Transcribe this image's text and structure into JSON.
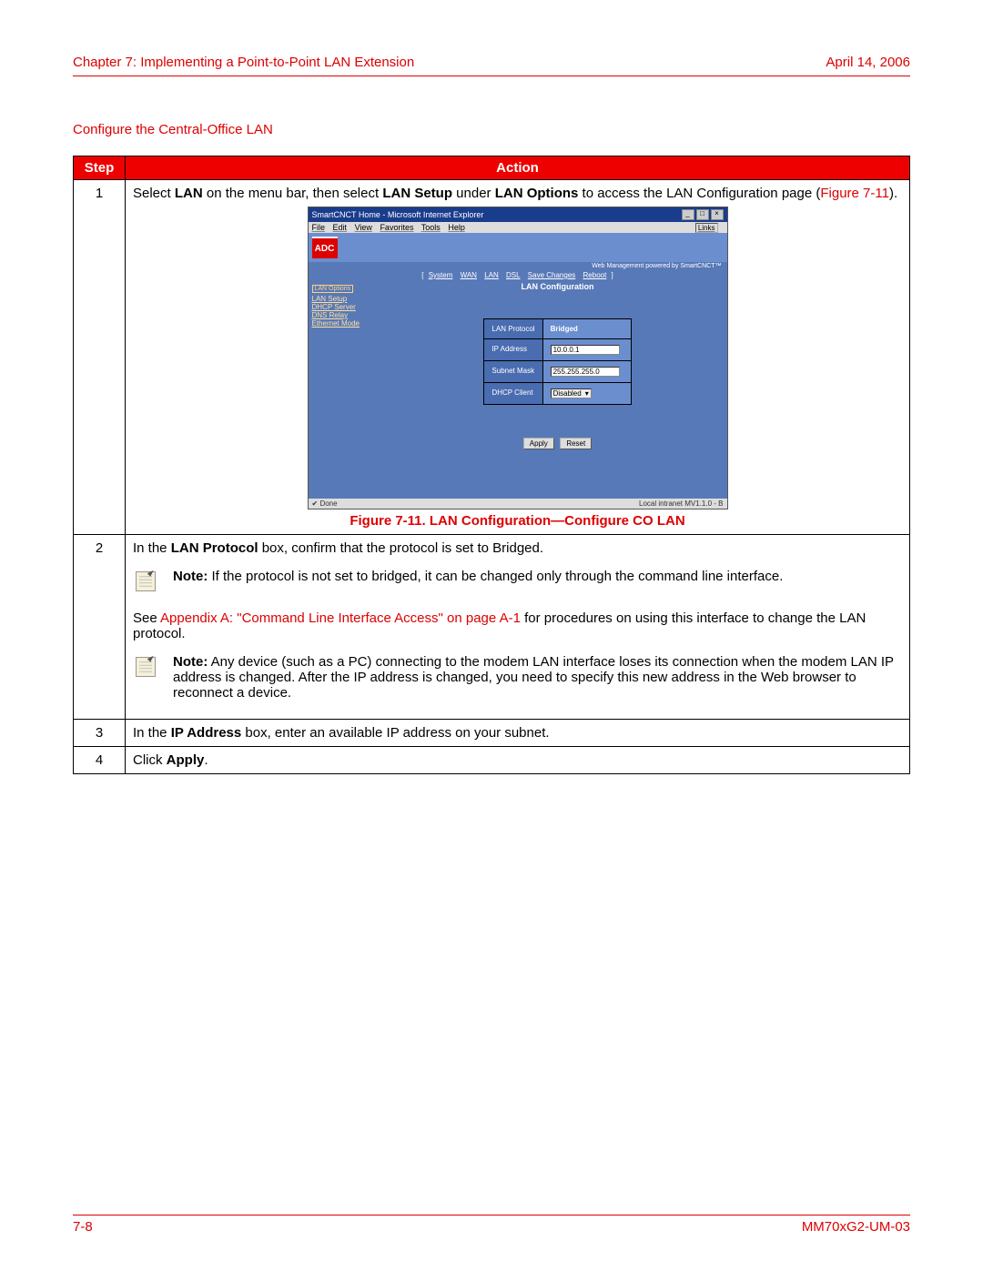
{
  "header": {
    "chapter": "Chapter 7: Implementing a Point-to-Point LAN Extension",
    "date": "April 14, 2006"
  },
  "section_title": "Configure the Central-Office LAN",
  "table": {
    "head_step": "Step",
    "head_action": "Action",
    "rows": {
      "r1": {
        "num": "1",
        "pre": "Select ",
        "b1": "LAN",
        "mid1": " on the menu bar, then select ",
        "b2": "LAN Setup",
        "mid2": " under ",
        "b3": "LAN Options",
        "mid3": " to access the LAN Configuration page (",
        "figref": "Figure 7-11",
        "post": ")."
      },
      "fig_caption": "Figure 7-11. LAN Configuration—Configure CO LAN",
      "r2": {
        "num": "2",
        "pre": "In the ",
        "b1": "LAN Protocol",
        "post": " box, confirm that the protocol is set to Bridged.",
        "note1_label": "Note:",
        "note1": " If the protocol is not set to bridged, it can be changed only through the command line interface.",
        "see_pre": "See ",
        "see_link": "Appendix A: \"Command Line Interface Access\" on page A-1",
        "see_post": " for procedures on using this interface to change the LAN protocol.",
        "note2_label": "Note:",
        "note2": " Any device (such as a PC) connecting to the modem LAN interface loses its connection when the modem LAN IP address is changed. After the IP address is changed, you need to specify this new address in the Web browser to reconnect a device."
      },
      "r3": {
        "num": "3",
        "pre": "In the ",
        "b1": "IP Address",
        "post": " box, enter an available IP address on your subnet."
      },
      "r4": {
        "num": "4",
        "pre": "Click ",
        "b1": "Apply",
        "post": "."
      }
    }
  },
  "screenshot": {
    "title": "SmartCNCT Home - Microsoft Internet Explorer",
    "menu": [
      "File",
      "Edit",
      "View",
      "Favorites",
      "Tools",
      "Help"
    ],
    "links_label": "Links",
    "logo": "ADC",
    "top_right": "Web Management powered by SmartCNCT™",
    "tabs": [
      "System",
      "WAN",
      "LAN",
      "DSL",
      "Save Changes",
      "Reboot"
    ],
    "side_label": "LAN Options",
    "side_items": [
      "LAN Setup",
      "DHCP Server",
      "DNS Relay",
      "Ethernet Mode"
    ],
    "main_title": "LAN Configuration",
    "cfg": {
      "lan_protocol_label": "LAN Protocol",
      "lan_protocol_value": "Bridged",
      "ip_label": "IP Address",
      "ip_value": "10.0.0.1",
      "subnet_label": "Subnet Mask",
      "subnet_value": "255.255.255.0",
      "dhcp_label": "DHCP Client",
      "dhcp_value": "Disabled"
    },
    "buttons": {
      "apply": "Apply",
      "reset": "Reset"
    },
    "status_left": "Done",
    "status_right": "Local intranet  MV1.1.0 - B"
  },
  "footer": {
    "page": "7-8",
    "doc": "MM70xG2-UM-03"
  }
}
